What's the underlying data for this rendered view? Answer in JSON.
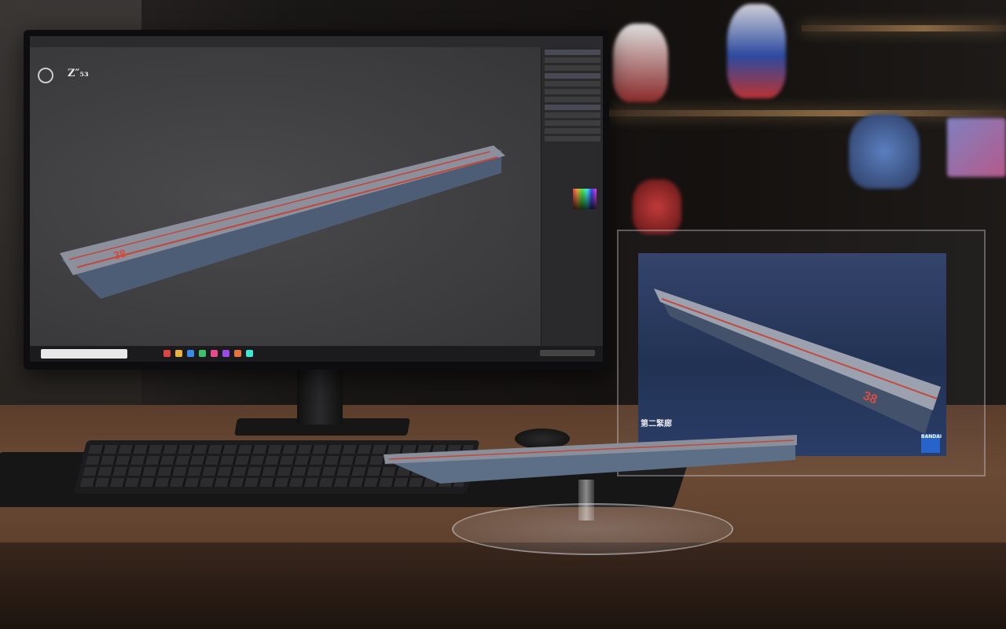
{
  "scene": {
    "description_tags": [
      "desk",
      "monitor",
      "keyboard",
      "mouse",
      "display-case",
      "ship-model"
    ]
  },
  "app": {
    "logo_text": "Z″₅₃"
  },
  "ship_model": {
    "hull_number": "38"
  },
  "display_case": {
    "poster_caption": "第二緊廊",
    "badge": "BANDAI"
  },
  "colors": {
    "deck": "#8a8f9c",
    "deck_stripe": "#c2473a",
    "hull": "#5d6f86",
    "hull_dark": "#3a4a5e"
  }
}
